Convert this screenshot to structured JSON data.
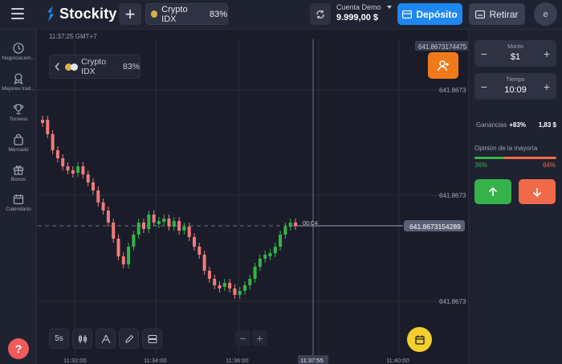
{
  "header": {
    "brand": "Stockity",
    "asset_tab": {
      "name": "Crypto IDX",
      "payout": "83%"
    },
    "account": {
      "label": "Cuenta Demo",
      "balance": "9.999,00 $"
    },
    "deposit_label": "Depósito",
    "withdraw_label": "Retirar",
    "avatar_initial": "e"
  },
  "sidebar": {
    "items": [
      {
        "label": "Negociacion...",
        "icon": "clock-icon"
      },
      {
        "label": "Mejores trad...",
        "icon": "ribbon-icon"
      },
      {
        "label": "Torneos",
        "icon": "trophy-icon"
      },
      {
        "label": "Mercado",
        "icon": "bag-icon"
      },
      {
        "label": "Bonos",
        "icon": "gift-icon"
      },
      {
        "label": "Calendario",
        "icon": "calendar-icon"
      }
    ],
    "help_label": "?"
  },
  "chart": {
    "server_time": "11:37:25 GMT+7",
    "asset_chip": {
      "name": "Crypto IDX",
      "payout": "83%"
    },
    "price_labels": [
      "641.8673174475",
      "641.8673",
      "641.8673",
      "641.8673"
    ],
    "current_price": "641.8673154289",
    "countdown": "00:C4",
    "time_labels": [
      "11:32:00",
      "11:34:00",
      "11:36:00",
      "11:37:55",
      "11:40:00"
    ],
    "timeframe": "5s",
    "colors": {
      "up": "#35b34a",
      "down": "#f07b7b",
      "grid": "#2a2e3d"
    }
  },
  "chart_data": {
    "type": "candlestick",
    "up_color": "#35b34a",
    "down_color": "#f07b7b"
  },
  "panel": {
    "amount": {
      "caption": "Monto",
      "value": "$1"
    },
    "time": {
      "caption": "Tiempo",
      "value": "10:09"
    },
    "earnings": {
      "label": "Ganancias",
      "pct": "+83%",
      "amount": "1,83 $"
    },
    "opinion": {
      "label": "Opinión de la mayoría",
      "up_pct": "36%",
      "down_pct": "64%",
      "up_fraction": 0.36
    }
  }
}
